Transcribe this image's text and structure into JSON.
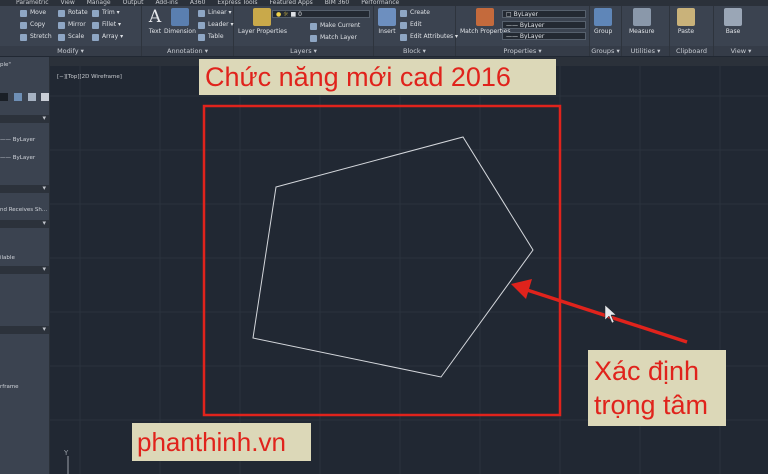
{
  "menu": {
    "tabs": [
      "Parametric",
      "View",
      "Manage",
      "Output",
      "Add-ins",
      "A360",
      "Express Tools",
      "Featured Apps",
      "BIM 360",
      "Performance"
    ]
  },
  "ribbon": {
    "modify": {
      "label": "Modify ▾",
      "move": "Move",
      "rotate": "Rotate",
      "trim": "Trim ▾",
      "copy": "Copy",
      "mirror": "Mirror",
      "fillet": "Fillet ▾",
      "stretch": "Stretch",
      "scale": "Scale",
      "array": "Array ▾"
    },
    "annotation": {
      "label": "Annotation ▾",
      "text": "Text",
      "dimension": "Dimension",
      "linear": "Linear ▾",
      "leader": "Leader ▾",
      "table": "Table"
    },
    "layers": {
      "label": "Layers ▾",
      "layer_properties": "Layer Properties",
      "layer_value": "0",
      "make_current": "Make Current",
      "match_layer": "Match Layer"
    },
    "block": {
      "label": "Block ▾",
      "insert": "Insert",
      "create": "Create",
      "edit": "Edit",
      "edit_attributes": "Edit Attributes ▾"
    },
    "properties": {
      "label": "Properties ▾",
      "match_properties": "Match Properties",
      "color": "ByLayer",
      "linetype": "ByLayer",
      "lineweight": "ByLayer"
    },
    "groups": {
      "label": "Groups ▾",
      "group": "Group"
    },
    "utilities": {
      "label": "Utilities ▾",
      "measure": "Measure"
    },
    "clipboard": {
      "label": "Clipboard",
      "paste": "Paste"
    },
    "view": {
      "label": "View ▾",
      "base": "Base"
    }
  },
  "palette": {
    "tab_label": "ple\"",
    "bylayer_1": "ByLayer",
    "bylayer_2": "ByLayer",
    "receives_shadows": "nd Receives Sh...",
    "alable": "ilable",
    "frame": "rframe"
  },
  "viewport": {
    "label": "[−][Top][2D Wireframe]"
  },
  "overlay": {
    "title": "Chức năng mới cad 2016",
    "note_line1": "Xác định",
    "note_line2": "trọng tâm",
    "site": "phanthinh.vn"
  },
  "colors": {
    "annotation_red": "#e0231c",
    "caption_bg": "#dcd8b8",
    "canvas_bg": "#212833",
    "ribbon_bg": "#3b4350"
  }
}
